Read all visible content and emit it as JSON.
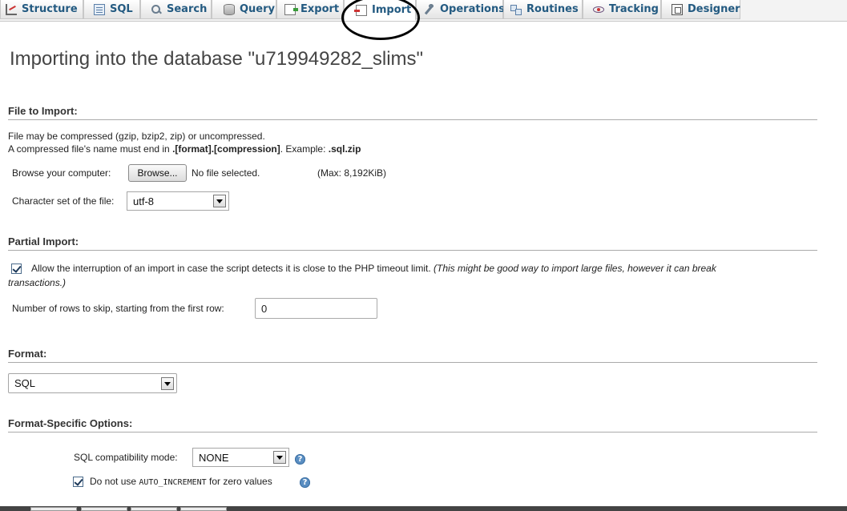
{
  "tabs": [
    {
      "label": "Structure",
      "icon": "structure-icon"
    },
    {
      "label": "SQL",
      "icon": "sql-icon"
    },
    {
      "label": "Search",
      "icon": "search-icon"
    },
    {
      "label": "Query",
      "icon": "query-icon"
    },
    {
      "label": "Export",
      "icon": "export-icon"
    },
    {
      "label": "Import",
      "icon": "import-icon",
      "active": true
    },
    {
      "label": "Operations",
      "icon": "operations-icon"
    },
    {
      "label": "Routines",
      "icon": "routines-icon"
    },
    {
      "label": "Tracking",
      "icon": "tracking-icon"
    },
    {
      "label": "Designer",
      "icon": "designer-icon"
    }
  ],
  "page": {
    "title": "Importing into the database \"u719949282_slims\""
  },
  "file_import": {
    "heading": "File to Import:",
    "line1": "File may be compressed (gzip, bzip2, zip) or uncompressed.",
    "line2_prefix": "A compressed file's name must end in ",
    "line2_format": ".[format].[compression]",
    "line2_mid": ". Example: ",
    "line2_example": ".sql.zip",
    "browse_label": "Browse your computer:",
    "browse_button": "Browse...",
    "no_file": "No file selected.",
    "max_size": "(Max: 8,192KiB)",
    "charset_label": "Character set of the file:",
    "charset_value": "utf-8"
  },
  "partial_import": {
    "heading": "Partial Import:",
    "allow_interrupt_checked": true,
    "allow_interrupt_text": "Allow the interruption of an import in case the script detects it is close to the PHP timeout limit.",
    "allow_interrupt_note_1": "(This might be good way to import large files, however it can break",
    "allow_interrupt_note_2": "transactions.)",
    "skip_rows_label": "Number of rows to skip, starting from the first row:",
    "skip_rows_value": "0"
  },
  "format": {
    "heading": "Format:",
    "value": "SQL"
  },
  "format_options": {
    "heading": "Format-Specific Options:",
    "compat_label": "SQL compatibility mode:",
    "compat_value": "NONE",
    "no_auto_inc_checked": true,
    "no_auto_inc_prefix": "Do not use",
    "no_auto_inc_code": "AUTO_INCREMENT",
    "no_auto_inc_suffix": "for zero values"
  }
}
